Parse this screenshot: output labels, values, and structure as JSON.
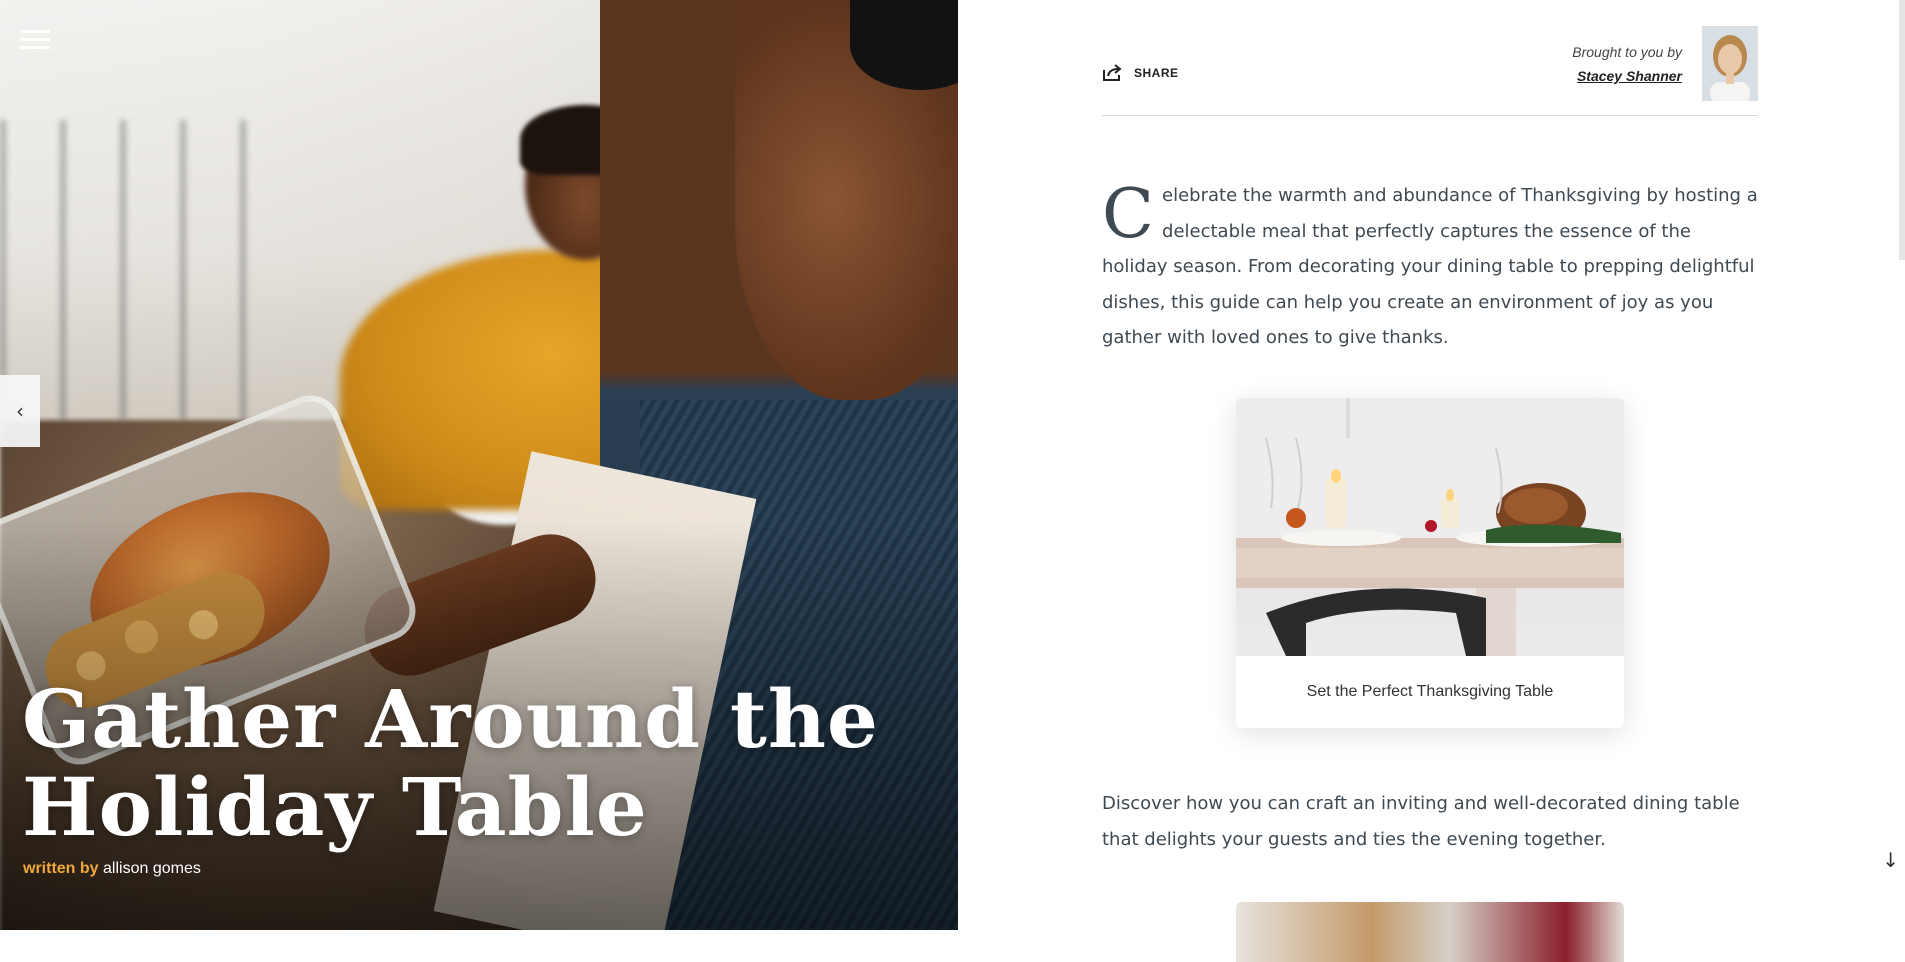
{
  "hero": {
    "title_line1": "Gather Around the",
    "title_line2": "Holiday Table",
    "byline_prefix": "written by",
    "byline_author": "allison gomes"
  },
  "nav": {
    "menu_icon": "hamburger-icon",
    "prev_arrow": "‹",
    "next_arrow": "›",
    "scroll_down": "↓"
  },
  "header": {
    "share_label": "SHARE",
    "share_icon": "share-icon",
    "sponsor_prefix": "Brought to you by",
    "sponsor_name": "Stacey Shanner"
  },
  "article": {
    "intro_dropcap": "C",
    "intro_text": "elebrate the warmth and abundance of Thanksgiving by hosting a delectable meal that perfectly captures the essence of the holiday season. From decorating your dining table to prepping delightful dishes, this guide can help you create an environment of joy as you gather with loved ones to give thanks.",
    "card1_caption": "Set the Perfect Thanksgiving Table",
    "paragraph2": "Discover how you can craft an inviting and well-decorated dining table that delights your guests and ties the evening together."
  },
  "colors": {
    "byline_accent": "#f0a83a",
    "body_text": "#3f4952",
    "divider": "#d9d9d9"
  }
}
